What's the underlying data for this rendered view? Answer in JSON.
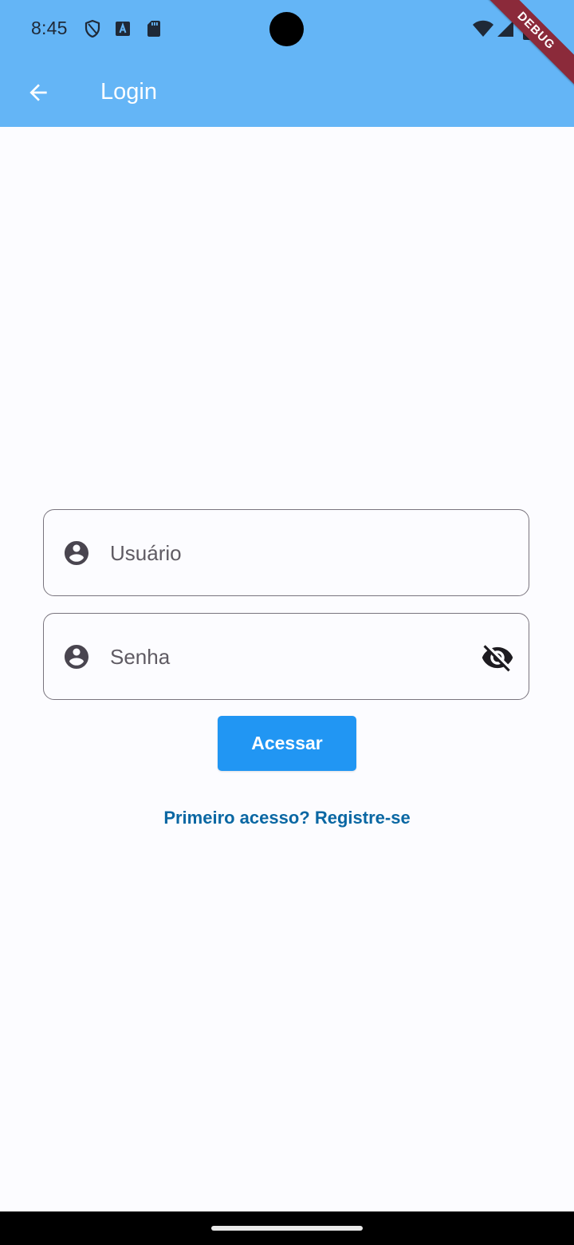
{
  "status_bar": {
    "time": "8:45",
    "icons": [
      "shield-icon",
      "accessibility-a-icon",
      "sd-card-icon",
      "wifi-icon",
      "signal-icon",
      "battery-icon"
    ]
  },
  "debug_banner": "DEBUG",
  "app_bar": {
    "back_icon": "arrow-back-icon",
    "title": "Login"
  },
  "form": {
    "username": {
      "icon": "account-circle-icon",
      "placeholder": "Usuário"
    },
    "password": {
      "icon": "account-circle-icon",
      "placeholder": "Senha",
      "toggle_icon": "visibility-off-icon"
    },
    "submit_label": "Acessar",
    "register_link": "Primeiro acesso? Registre-se"
  },
  "colors": {
    "app_bar": "#64b5f6",
    "button": "#2196f3",
    "link": "#0a67a3",
    "background": "#fcfcff"
  }
}
